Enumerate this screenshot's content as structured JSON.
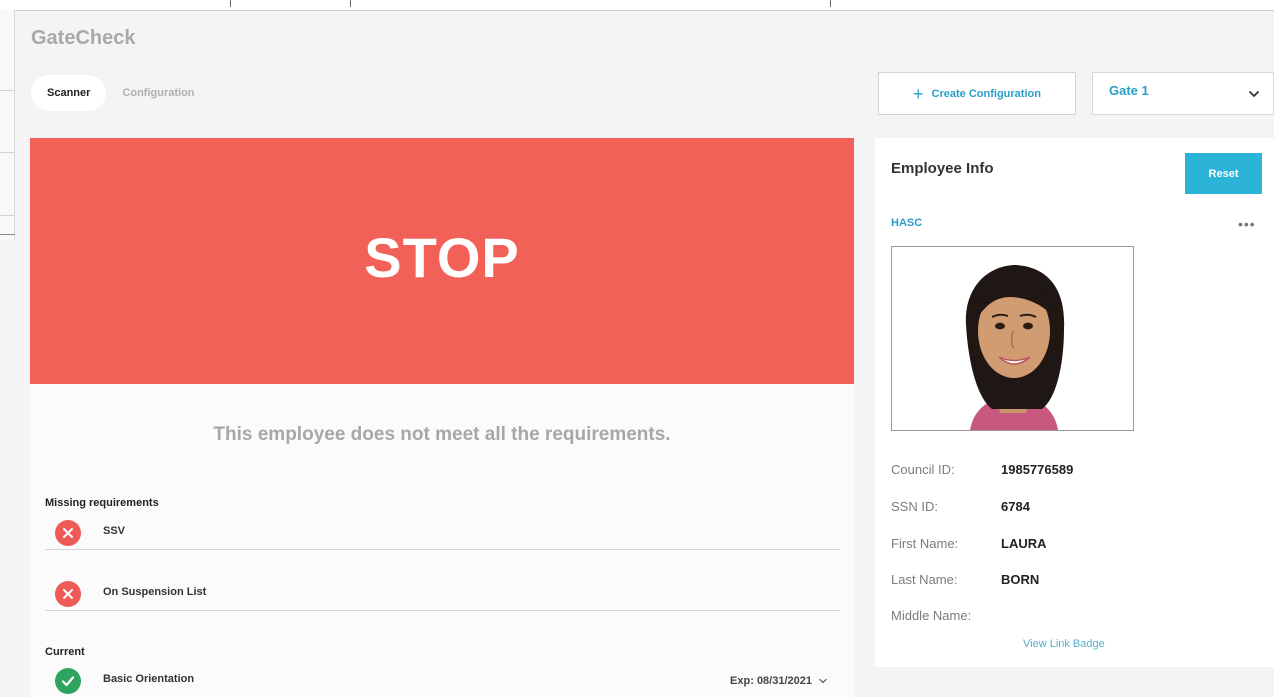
{
  "app": {
    "title": "GateCheck"
  },
  "tabs": [
    {
      "label": "Scanner",
      "active": true
    },
    {
      "label": "Configuration",
      "active": false
    }
  ],
  "toolbar": {
    "create_label": "Create Configuration",
    "gate_selected": "Gate 1"
  },
  "status": {
    "banner": "STOP",
    "banner_color": "#f26157",
    "message": "This employee does not meet all the requirements."
  },
  "missing": {
    "heading": "Missing requirements",
    "items": [
      {
        "label": "SSV",
        "status": "missing"
      },
      {
        "label": "On Suspension List",
        "status": "missing"
      }
    ]
  },
  "current": {
    "heading": "Current",
    "items": [
      {
        "label": "Basic Orientation",
        "status": "ok",
        "expiry": "Exp: 08/31/2021"
      }
    ]
  },
  "employee": {
    "title": "Employee Info",
    "reset_label": "Reset",
    "org": "HASC",
    "more_label": "•••",
    "fields": [
      {
        "label": "Council ID:",
        "value": "1985776589"
      },
      {
        "label": "SSN ID:",
        "value": "6784"
      },
      {
        "label": "First Name:",
        "value": "LAURA"
      },
      {
        "label": "Last Name:",
        "value": "BORN"
      },
      {
        "label": "Middle Name:",
        "value": ""
      }
    ],
    "link_label": "View Link Badge"
  },
  "colors": {
    "accent": "#2a9fc5",
    "reset": "#2bb3d8",
    "error": "#ee5a56",
    "ok": "#2fa45f"
  },
  "icons": {
    "create": "plus-icon",
    "gate_select": "chevron-down-icon",
    "missing_item": "x-circle-icon",
    "current_item": "check-circle-icon",
    "expiry": "chevron-down-icon",
    "more": "more-horizontal-icon"
  }
}
